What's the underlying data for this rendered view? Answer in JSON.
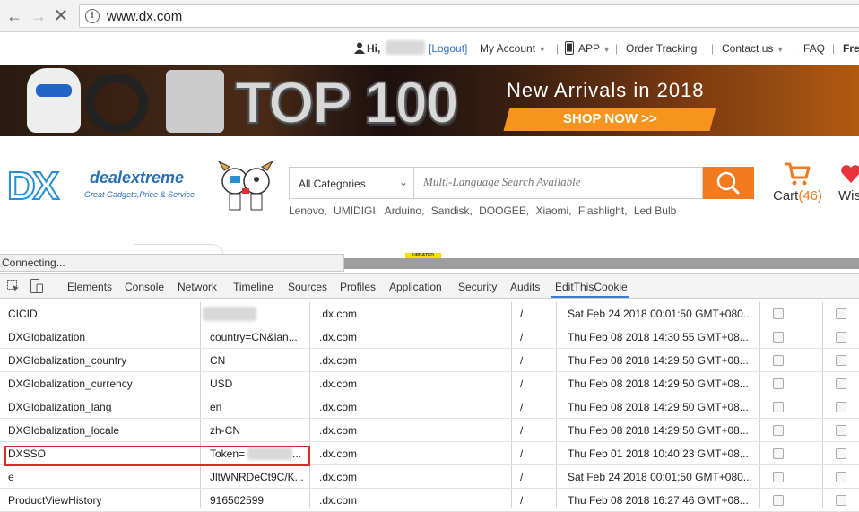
{
  "browser": {
    "url": "www.dx.com",
    "back_icon": "arrow-left",
    "forward_icon": "arrow-right",
    "reload_icon": "close-x",
    "info_icon": "info-circle"
  },
  "top_links": {
    "greeting": "Hi,",
    "logout": "[Logout]",
    "my_account": "My Account",
    "app": "APP",
    "order_tracking": "Order Tracking",
    "contact_us": "Contact us",
    "faq": "FAQ",
    "free": "Fre"
  },
  "banner": {
    "headline": "TOP 100",
    "subline": "New Arrivals in 2018",
    "cta": "SHOP NOW >>"
  },
  "header": {
    "logo_dx": "DX",
    "logo_deal": "dealextreme",
    "logo_tagline": "Great Gadgets,Price & Service",
    "category": "All Categories",
    "search_placeholder": "Multi-Language Search Available",
    "hot_words": [
      "Lenovo,",
      "UMIDIGI,",
      "Arduino,",
      "Sandisk,",
      "DOOGEE,",
      "Xiaomi,",
      "Flashlight,",
      "Led Bulb"
    ],
    "cart_label": "Cart",
    "cart_count": "(46)",
    "wish_label": "Wis"
  },
  "status": {
    "text": "Connecting...",
    "updated_badge": "UPDATED"
  },
  "devtools": {
    "tabs": [
      "Elements",
      "Console",
      "Network",
      "Timeline",
      "Sources",
      "Profiles",
      "Application",
      "Security",
      "Audits",
      "EditThisCookie"
    ],
    "active_tab": "EditThisCookie"
  },
  "cookies": [
    {
      "name": "CICID",
      "value": "",
      "domain": ".dx.com",
      "path": "/",
      "expires": "Sat Feb 24 2018 00:01:50 GMT+080..."
    },
    {
      "name": "DXGlobalization",
      "value": "country=CN&lan...",
      "domain": ".dx.com",
      "path": "/",
      "expires": "Thu Feb 08 2018 14:30:55 GMT+08..."
    },
    {
      "name": "DXGlobalization_country",
      "value": "CN",
      "domain": ".dx.com",
      "path": "/",
      "expires": "Thu Feb 08 2018 14:29:50 GMT+08..."
    },
    {
      "name": "DXGlobalization_currency",
      "value": "USD",
      "domain": ".dx.com",
      "path": "/",
      "expires": "Thu Feb 08 2018 14:29:50 GMT+08..."
    },
    {
      "name": "DXGlobalization_lang",
      "value": "en",
      "domain": ".dx.com",
      "path": "/",
      "expires": "Thu Feb 08 2018 14:29:50 GMT+08..."
    },
    {
      "name": "DXGlobalization_locale",
      "value": "zh-CN",
      "domain": ".dx.com",
      "path": "/",
      "expires": "Thu Feb 08 2018 14:29:50 GMT+08..."
    },
    {
      "name": "DXSSO",
      "value": "Token=",
      "value_tail": "...",
      "domain": ".dx.com",
      "path": "/",
      "expires": "Thu Feb 01 2018 10:40:23 GMT+08..."
    },
    {
      "name": "e",
      "value": "JltWNRDeCt9C/K...",
      "domain": ".dx.com",
      "path": "/",
      "expires": "Sat Feb 24 2018 00:01:50 GMT+080..."
    },
    {
      "name": "ProductViewHistory",
      "value": "916502599",
      "domain": ".dx.com",
      "path": "/",
      "expires": "Thu Feb 08 2018 16:27:46 GMT+08..."
    }
  ],
  "colors": {
    "accent_orange": "#f47a20",
    "highlight_red": "#d92b2b",
    "devtools_tab_blue": "#3879d9"
  }
}
